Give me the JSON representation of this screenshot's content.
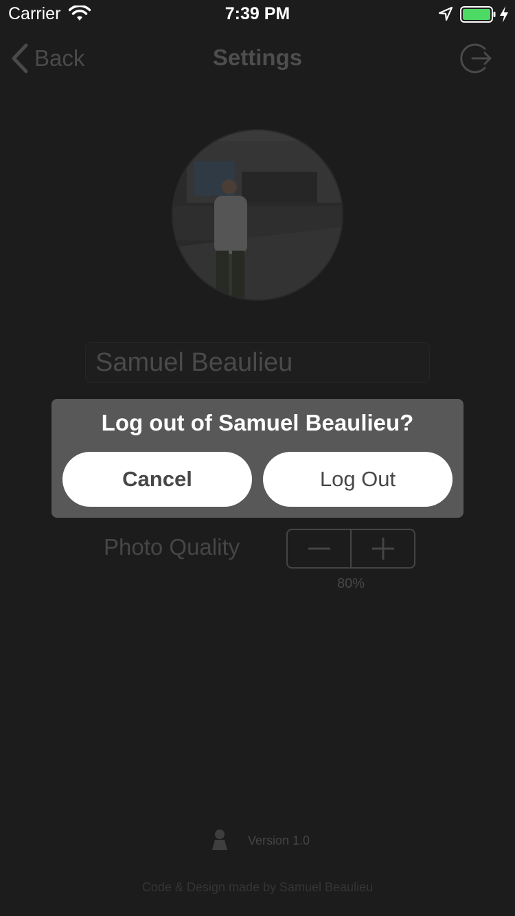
{
  "status_bar": {
    "carrier": "Carrier",
    "time": "7:39 PM",
    "icons": [
      "wifi-icon",
      "location-arrow-icon",
      "battery-icon",
      "charging-bolt-icon"
    ],
    "battery_color": "#4cd964"
  },
  "nav": {
    "back_label": "Back",
    "title": "Settings",
    "right_icon": "logout-icon"
  },
  "profile": {
    "name": "Samuel Beaulieu"
  },
  "photo_quality": {
    "label": "Photo Quality",
    "value": "80%",
    "decrement_icon": "minus-icon",
    "increment_icon": "plus-icon"
  },
  "footer": {
    "version": "Version 1.0",
    "credits": "Code & Design made by Samuel Beaulieu"
  },
  "alert": {
    "title": "Log out of Samuel Beaulieu?",
    "cancel_label": "Cancel",
    "confirm_label": "Log Out"
  },
  "colors": {
    "background": "#1c1c1c",
    "alert_background": "#585858",
    "button_background": "#ffffff",
    "button_text": "#474747"
  }
}
